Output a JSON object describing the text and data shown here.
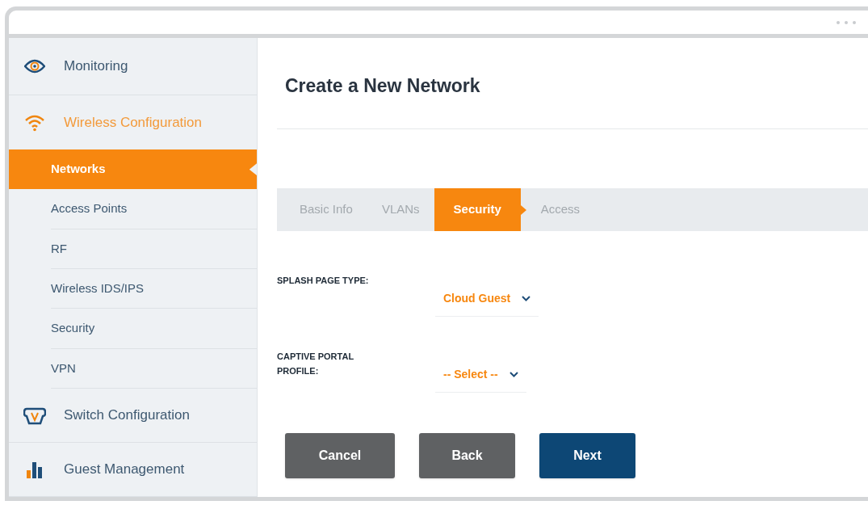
{
  "sidebar": {
    "sections": [
      {
        "label": "Monitoring",
        "kind": "eye",
        "selected": false
      },
      {
        "label": "Wireless Configuration",
        "kind": "wifi",
        "selected": true,
        "children": [
          {
            "label": "Networks",
            "selected": true
          },
          {
            "label": "Access Points",
            "selected": false
          },
          {
            "label": "RF",
            "selected": false
          },
          {
            "label": "Wireless IDS/IPS",
            "selected": false
          },
          {
            "label": "Security",
            "selected": false
          },
          {
            "label": "VPN",
            "selected": false
          }
        ]
      },
      {
        "label": "Switch Configuration",
        "kind": "switch",
        "selected": false
      },
      {
        "label": "Guest Management",
        "kind": "bars",
        "selected": false
      }
    ]
  },
  "main": {
    "title": "Create a New Network",
    "steps": [
      {
        "label": "Basic Info",
        "selected": false
      },
      {
        "label": "VLANs",
        "selected": false
      },
      {
        "label": "Security",
        "selected": true
      },
      {
        "label": "Access",
        "selected": false
      }
    ],
    "fields": [
      {
        "label": "SPLASH PAGE TYPE:",
        "value": "Cloud Guest"
      },
      {
        "label": "CAPTIVE PORTAL PROFILE:",
        "value": "-- Select --"
      }
    ],
    "buttons": [
      {
        "label": "Cancel",
        "kind": "secondary"
      },
      {
        "label": "Back",
        "kind": "secondary"
      },
      {
        "label": "Next",
        "kind": "primary"
      }
    ]
  }
}
